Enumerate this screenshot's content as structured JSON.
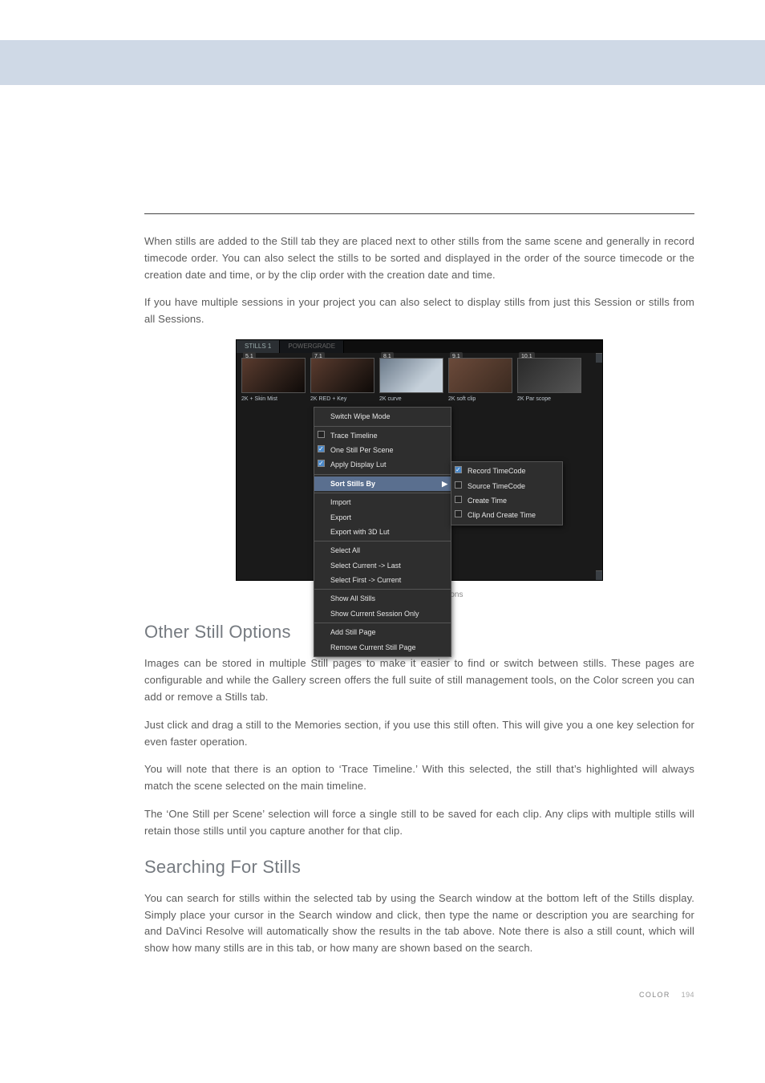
{
  "para1": "When stills are added to the Still tab they are placed next to other stills from the same scene and generally in record timecode order. You can also select the stills to be sorted and displayed in the order of the source timecode or the creation date and time, or by the clip order with the creation date and time.",
  "para2": "If you have multiple sessions in your project you can also select to display stills from just this Session or stills from all Sessions.",
  "figure": {
    "tabs": {
      "active": "STILLS 1",
      "inactive": "POWERGRADE"
    },
    "thumbs": [
      {
        "badge": "5.1",
        "label": "2K + Skin Mist"
      },
      {
        "badge": "7.1",
        "label": "2K RED + Key"
      },
      {
        "badge": "8.1",
        "label": "2K curve"
      },
      {
        "badge": "9.1",
        "label": "2K soft clip"
      },
      {
        "badge": "10.1",
        "label": "2K Par scope"
      }
    ],
    "menu": {
      "g1": [
        "Switch Wipe Mode"
      ],
      "g2": [
        {
          "label": "Trace Timeline",
          "checked": false
        },
        {
          "label": "One Still Per Scene",
          "checked": true
        },
        {
          "label": "Apply Display Lut",
          "checked": true
        }
      ],
      "g3_hl": "Sort Stills By",
      "g4": [
        "Import",
        "Export",
        "Export with 3D Lut"
      ],
      "g5": [
        "Select All",
        "Select Current -> Last",
        "Select First -> Current"
      ],
      "g6": [
        "Show All Stills",
        "Show Current Session Only"
      ],
      "g7": [
        "Add Still Page",
        "Remove Current Still Page"
      ]
    },
    "submenu": [
      {
        "label": "Record TimeCode",
        "checked": true
      },
      {
        "label": "Source TimeCode",
        "checked": false
      },
      {
        "label": "Create Time",
        "checked": false
      },
      {
        "label": "Clip And Create Time",
        "checked": false
      }
    ]
  },
  "caption": "Stills Right Click Options",
  "h_other": "Other Still Options",
  "p_other1": "Images can be stored in multiple Still pages to make it easier to find or switch between stills. These pages are configurable and while the Gallery screen offers the full suite of still management tools, on the Color screen you can add or remove a Stills tab.",
  "p_other2": "Just click and drag a still to the Memories section, if you use this still often. This will give you a one key selection for even faster operation.",
  "p_other3": "You will note that there is an option to ‘Trace Timeline.’ With this selected, the still that’s highlighted will always match the scene selected on the main timeline.",
  "p_other4": "The ‘One Still per Scene’ selection will force a single still to be saved for each clip. Any clips with multiple stills will retain those stills until you capture another for that clip.",
  "h_search": "Searching For Stills",
  "p_search": "You can search for stills within the selected tab by using the Search window at the bottom left of the Stills display. Simply place your cursor in the Search window and click, then type the name or description you are searching for and DaVinci Resolve will automatically show the results in the tab above. Note there is also a still count, which will show how many stills are in this tab, or how many are shown based on the search.",
  "footer_section": "COLOR",
  "footer_page": "194"
}
